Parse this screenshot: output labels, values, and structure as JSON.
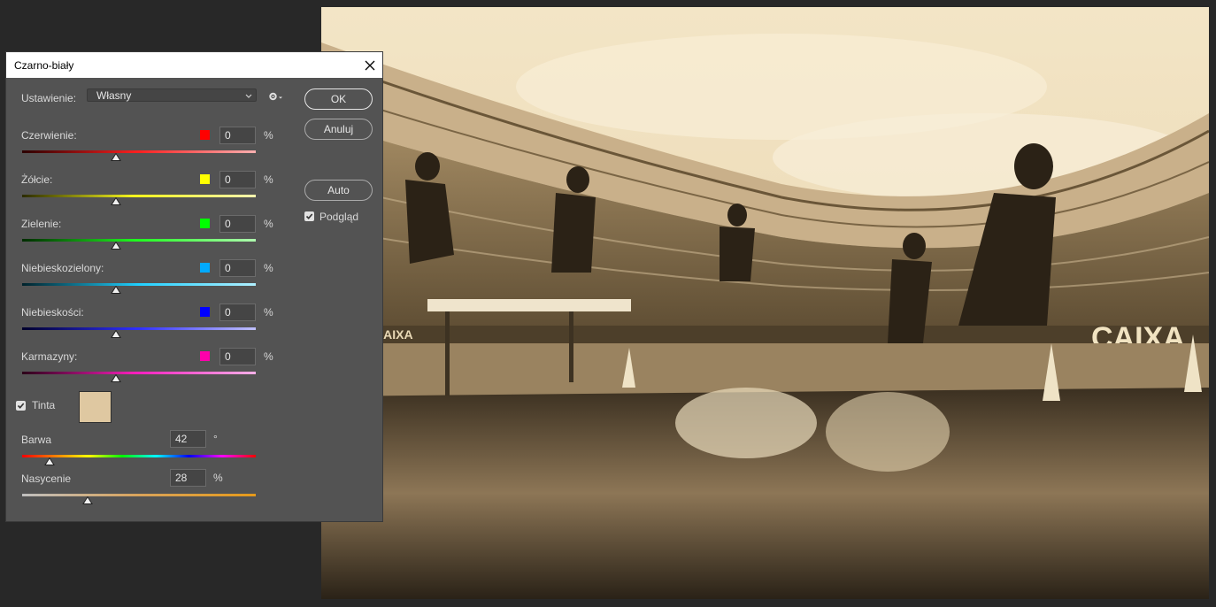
{
  "dialog": {
    "title": "Czarno-biały",
    "preset": {
      "label": "Ustawienie:",
      "value": "Własny"
    },
    "buttons": {
      "ok": "OK",
      "cancel": "Anuluj",
      "auto": "Auto"
    },
    "preview": {
      "label": "Podgląd",
      "checked": true
    },
    "channels": [
      {
        "label": "Czerwienie:",
        "value": "0",
        "unit": "%",
        "swatch": "#ff0000",
        "position": 0.4,
        "gradient": [
          "#2b0000",
          "#ff2020",
          "#ffb0b0"
        ]
      },
      {
        "label": "Żółcie:",
        "value": "0",
        "unit": "%",
        "swatch": "#ffff00",
        "position": 0.4,
        "gradient": [
          "#2b2b00",
          "#ffff20",
          "#ffffb0"
        ]
      },
      {
        "label": "Zielenie:",
        "value": "0",
        "unit": "%",
        "swatch": "#00ff00",
        "position": 0.4,
        "gradient": [
          "#002b00",
          "#20ff20",
          "#b0ffb0"
        ]
      },
      {
        "label": "Niebieskozielony:",
        "value": "0",
        "unit": "%",
        "swatch": "#00aaff",
        "position": 0.4,
        "gradient": [
          "#00222b",
          "#20d0ff",
          "#b0f0ff"
        ]
      },
      {
        "label": "Niebieskości:",
        "value": "0",
        "unit": "%",
        "swatch": "#0000ff",
        "position": 0.4,
        "gradient": [
          "#00002b",
          "#3030ff",
          "#c0c0ff"
        ]
      },
      {
        "label": "Karmazyny:",
        "value": "0",
        "unit": "%",
        "swatch": "#ff00aa",
        "position": 0.4,
        "gradient": [
          "#2b0018",
          "#ff20c0",
          "#ffb0e8"
        ]
      }
    ],
    "tint": {
      "label": "Tinta",
      "checked": true,
      "color": "#dfc8a1",
      "hue": {
        "label": "Barwa",
        "value": "42",
        "unit": "°",
        "position": 0.117
      },
      "saturation": {
        "label": "Nasycenie",
        "value": "28",
        "unit": "%",
        "position": 0.28
      }
    }
  },
  "colors": {
    "background": "#282828",
    "dialog": "#535353",
    "sepia": "#bfa57a"
  }
}
